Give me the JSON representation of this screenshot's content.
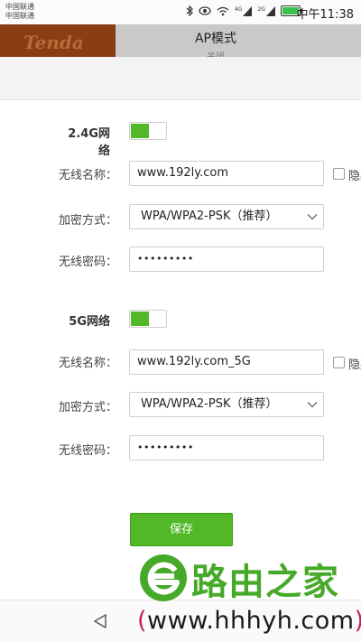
{
  "status_bar": {
    "carrier_1": "中国联通",
    "carrier_2": "中国联通",
    "time": "中午11:38",
    "icons": [
      "bluetooth-icon",
      "eye-icon",
      "wifi-icon",
      "signal-4g-icon",
      "signal-2g-icon",
      "battery-icon"
    ],
    "network_4g": "4G",
    "network_2g": "2G"
  },
  "header": {
    "logo": "Tenda",
    "title": "AP模式",
    "subtitle": "关闭"
  },
  "wifi_24g": {
    "section_label": "2.4G网络",
    "enabled": true,
    "ssid_label": "无线名称：",
    "ssid_value": "www.192ly.com",
    "hide_label": "隐藏",
    "encryption_label": "加密方式：",
    "encryption_value": "WPA/WPA2-PSK（推荐）",
    "password_label": "无线密码：",
    "password_value": "•••••••••"
  },
  "wifi_5g": {
    "section_label": "5G网络",
    "enabled": true,
    "ssid_label": "无线名称：",
    "ssid_value": "www.192ly.com_5G",
    "hide_label": "隐藏",
    "encryption_label": "加密方式：",
    "encryption_value": "WPA/WPA2-PSK（推荐）",
    "password_label": "无线密码：",
    "password_value": "•••••••••"
  },
  "save_label": "保存",
  "watermark": {
    "title": "路由之家",
    "url_open": "(",
    "url": "www.hhhyh.com",
    "url_close": ")"
  },
  "colors": {
    "accent_green": "#52b828",
    "logo_bg": "#8a3d14",
    "header_bg": "#c9c9c9",
    "watermark_green": "#47a92a",
    "watermark_pink": "#c81e5a"
  }
}
